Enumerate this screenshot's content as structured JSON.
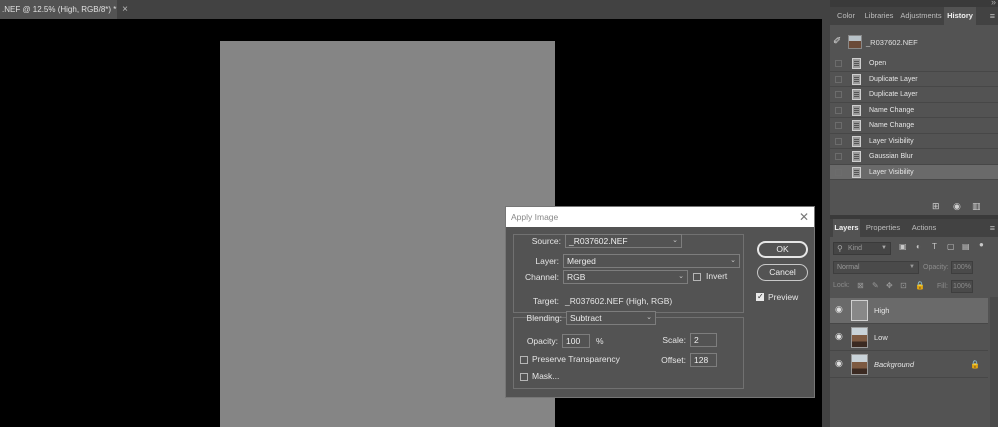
{
  "document": {
    "tab_title": ".NEF @ 12.5% (High, RGB/8*) *",
    "tab_close": "×"
  },
  "panel_header": {
    "collapse": "»"
  },
  "top_tabs": [
    {
      "label": "Color",
      "active": false
    },
    {
      "label": "Libraries",
      "active": false
    },
    {
      "label": "Adjustments",
      "active": false
    },
    {
      "label": "History",
      "active": true
    }
  ],
  "history": {
    "snapshot_label": "_R037602.NEF",
    "items": [
      {
        "label": "Open",
        "selected": false
      },
      {
        "label": "Duplicate Layer",
        "selected": false
      },
      {
        "label": "Duplicate Layer",
        "selected": false
      },
      {
        "label": "Name Change",
        "selected": false
      },
      {
        "label": "Name Change",
        "selected": false
      },
      {
        "label": "Layer Visibility",
        "selected": false
      },
      {
        "label": "Gaussian Blur",
        "selected": false
      },
      {
        "label": "Layer Visibility",
        "selected": true
      }
    ]
  },
  "layer_tabs": [
    {
      "label": "Layers",
      "active": true
    },
    {
      "label": "Properties",
      "active": false
    },
    {
      "label": "Actions",
      "active": false
    }
  ],
  "layers_panel": {
    "filter_placeholder": "Kind",
    "blend_mode": "Normal",
    "opacity_label": "Opacity:",
    "opacity_value": "100%",
    "lock_label": "Lock:",
    "fill_label": "Fill:",
    "fill_value": "100%",
    "layers": [
      {
        "name": "High",
        "selected": true,
        "thumb": "gray",
        "italic": false,
        "locked": false
      },
      {
        "name": "Low",
        "selected": false,
        "thumb": "photo",
        "italic": false,
        "locked": false
      },
      {
        "name": "Background",
        "selected": false,
        "thumb": "photo",
        "italic": true,
        "locked": true
      }
    ]
  },
  "dialog": {
    "title": "Apply Image",
    "source_label": "Source:",
    "source_value": "_R037602.NEF",
    "layer_label": "Layer:",
    "layer_value": "Merged",
    "channel_label": "Channel:",
    "channel_value": "RGB",
    "invert_label": "Invert",
    "invert_checked": false,
    "target_label": "Target:",
    "target_value": "_R037602.NEF (High, RGB)",
    "blending_label": "Blending:",
    "blending_value": "Subtract",
    "opacity_label": "Opacity:",
    "opacity_value": "100",
    "opacity_unit": "%",
    "scale_label": "Scale:",
    "scale_value": "2",
    "offset_label": "Offset:",
    "offset_value": "128",
    "preserve_label": "Preserve Transparency",
    "preserve_checked": false,
    "mask_label": "Mask...",
    "mask_checked": false,
    "ok_label": "OK",
    "cancel_label": "Cancel",
    "preview_label": "Preview",
    "preview_checked": true
  }
}
